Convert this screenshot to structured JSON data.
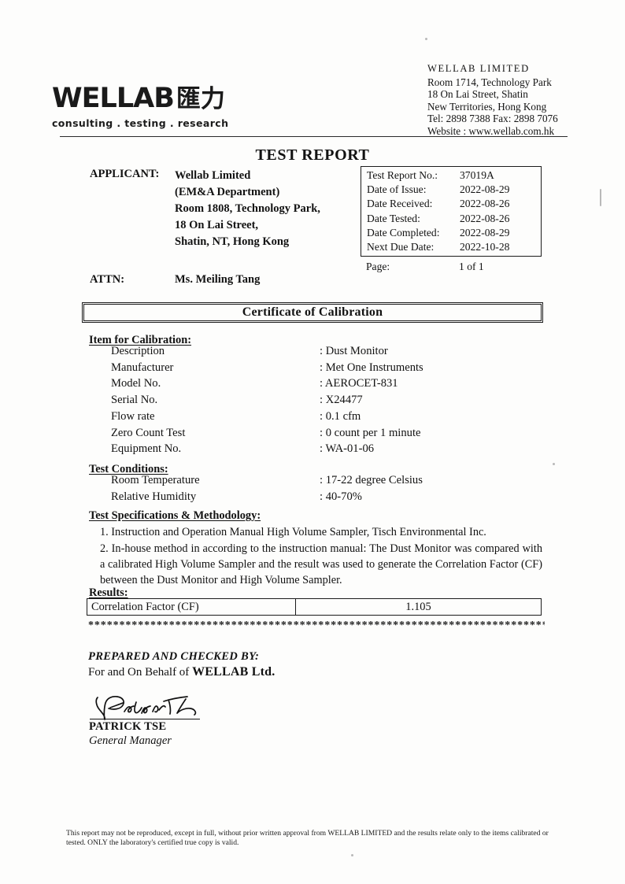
{
  "letterhead": {
    "logo_word": "WELLAB",
    "logo_cjk": "匯力",
    "tagline": "consulting . testing . research",
    "company_name": "WELLAB LIMITED",
    "address_line1": "Room 1714, Technology Park",
    "address_line2": "18 On Lai Street, Shatin",
    "address_line3": "New Territories, Hong Kong",
    "contact": "Tel: 2898 7388 Fax: 2898 7076",
    "website": "Website : www.wellab.com.hk"
  },
  "doc_title": "TEST REPORT",
  "applicant": {
    "label": "APPLICANT:",
    "lines": [
      "Wellab Limited",
      "(EM&A Department)",
      "Room 1808, Technology Park,",
      "18 On Lai Street,",
      "Shatin, NT, Hong Kong"
    ],
    "attn_label": "ATTN:",
    "attn_value": "Ms. Meiling Tang"
  },
  "info_box": {
    "rows": [
      {
        "key": "Test Report No.:",
        "value": "37019A"
      },
      {
        "key": "Date of Issue:",
        "value": "2022-08-29"
      },
      {
        "key": "Date Received:",
        "value": "2022-08-26"
      },
      {
        "key": "Date Tested:",
        "value": "2022-08-26"
      },
      {
        "key": "Date Completed:",
        "value": "2022-08-29"
      },
      {
        "key": "Next Due Date:",
        "value": "2022-10-28"
      }
    ],
    "page_key": "Page:",
    "page_value": "1 of 1"
  },
  "certificate_title": "Certificate of Calibration",
  "item_section": {
    "heading": "Item for Calibration:",
    "rows": [
      {
        "key": "Description",
        "value": ": Dust Monitor"
      },
      {
        "key": "Manufacturer",
        "value": ": Met One Instruments"
      },
      {
        "key": "Model No.",
        "value": ": AEROCET-831"
      },
      {
        "key": "Serial No.",
        "value": ": X24477"
      },
      {
        "key": "Flow rate",
        "value": ": 0.1 cfm"
      },
      {
        "key": "Zero Count Test",
        "value": ": 0 count per 1 minute"
      },
      {
        "key": "Equipment No.",
        "value": ": WA-01-06"
      }
    ]
  },
  "conditions_section": {
    "heading": "Test Conditions:",
    "rows": [
      {
        "key": "Room Temperature",
        "value": ": 17-22 degree Celsius"
      },
      {
        "key": "Relative Humidity",
        "value": ": 40-70%"
      }
    ]
  },
  "spec_section": {
    "heading": "Test Specifications & Methodology:",
    "items": [
      "1.  Instruction and Operation Manual High Volume Sampler, Tisch Environmental Inc.",
      "2. In-house method in according to the instruction manual:  The Dust Monitor was compared with a calibrated High Volume Sampler and the result was used to generate the Correlation Factor (CF) between the Dust Monitor and High Volume Sampler."
    ]
  },
  "results_section": {
    "heading": "Results:",
    "row_label": "Correlation Factor (CF)",
    "row_value": "1.105",
    "divider": "***************************************************************************************"
  },
  "signature": {
    "prepared_line": "PREPARED AND CHECKED BY:",
    "behalf_prefix": "For and On Behalf of ",
    "behalf_company": "WELLAB Ltd.",
    "name": "PATRICK TSE",
    "role": "General Manager"
  },
  "footer": {
    "text": "This report may not be reproduced, except in full, without prior written approval from WELLAB LIMITED and the results relate only to the items calibrated or tested. ONLY the laboratory's certified true copy is valid."
  }
}
